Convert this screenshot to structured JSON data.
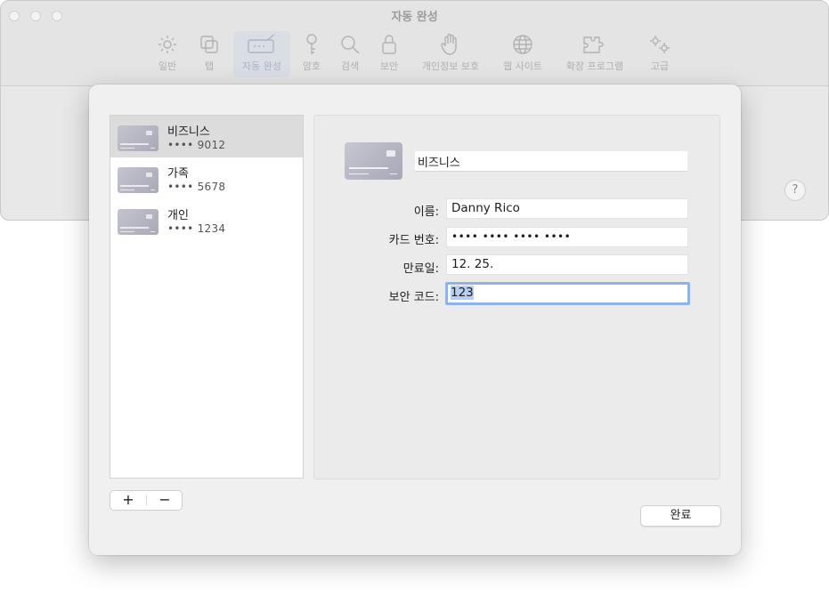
{
  "window": {
    "title": "자동 완성",
    "help_label": "?"
  },
  "toolbar": {
    "items": [
      {
        "label": "일반",
        "icon": "gear-icon"
      },
      {
        "label": "탭",
        "icon": "tabs-icon"
      },
      {
        "label": "자동 완성",
        "icon": "autofill-icon",
        "active": true
      },
      {
        "label": "암호",
        "icon": "key-icon"
      },
      {
        "label": "검색",
        "icon": "search-icon"
      },
      {
        "label": "보안",
        "icon": "lock-icon"
      },
      {
        "label": "개인정보 보호",
        "icon": "hand-icon"
      },
      {
        "label": "웹 사이트",
        "icon": "globe-icon"
      },
      {
        "label": "확장 프로그램",
        "icon": "puzzle-icon"
      },
      {
        "label": "고급",
        "icon": "gears-icon"
      }
    ]
  },
  "cards": [
    {
      "name": "비즈니스",
      "number": "•••• 9012",
      "selected": true
    },
    {
      "name": "가족",
      "number": "•••• 5678"
    },
    {
      "name": "개인",
      "number": "•••• 1234"
    }
  ],
  "detail": {
    "description": "비즈니스",
    "name_label": "이름:",
    "name_value": "Danny Rico",
    "number_label": "카드 번호:",
    "number_value": "•••• •••• •••• ••••",
    "expiry_label": "만료일:",
    "expiry_value": "12. 25.",
    "cvc_label": "보안 코드:",
    "cvc_value": "123"
  },
  "controls": {
    "add_label": "+",
    "remove_label": "−",
    "done_label": "완료"
  },
  "colors": {
    "accent": "#8fb3e8",
    "selection": "#b7d0f2",
    "row_selected": "#dcdcdc"
  }
}
